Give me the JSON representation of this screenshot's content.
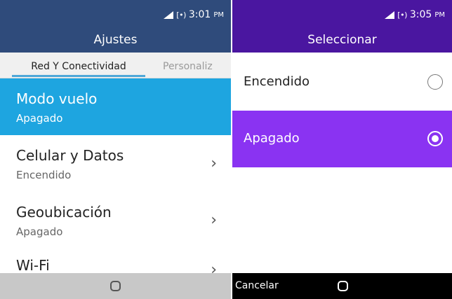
{
  "left": {
    "status": {
      "time": "3:01",
      "ampm": "PM",
      "battery": "[•)"
    },
    "title": "Ajustes",
    "tabs": [
      "Red Y Conectividad",
      "Personaliz"
    ],
    "rows": [
      {
        "title": "Modo vuelo",
        "subtitle": "Apagado",
        "chevron": ""
      },
      {
        "title": "Celular y Datos",
        "subtitle": "Encendido",
        "chevron": "›"
      },
      {
        "title": "Geoubicación",
        "subtitle": "Apagado",
        "chevron": "›"
      },
      {
        "title": "Wi-Fi",
        "subtitle": "",
        "chevron": "›"
      }
    ]
  },
  "right": {
    "status": {
      "time": "3:05",
      "ampm": "PM",
      "battery": "[•)"
    },
    "title": "Seleccionar",
    "options": [
      {
        "label": "Encendido",
        "selected": false
      },
      {
        "label": "Apagado",
        "selected": true
      }
    ],
    "softkey_left": "Cancelar"
  },
  "colors": {
    "left_header": "#2f4b7b",
    "highlight_blue": "#1ea5e0",
    "right_header": "#4a16a0",
    "highlight_purple": "#8a33f2"
  },
  "icons": [
    "signal-icon",
    "battery-icon",
    "chevron-right-icon",
    "radio-empty-icon",
    "radio-selected-icon",
    "home-key-icon"
  ]
}
